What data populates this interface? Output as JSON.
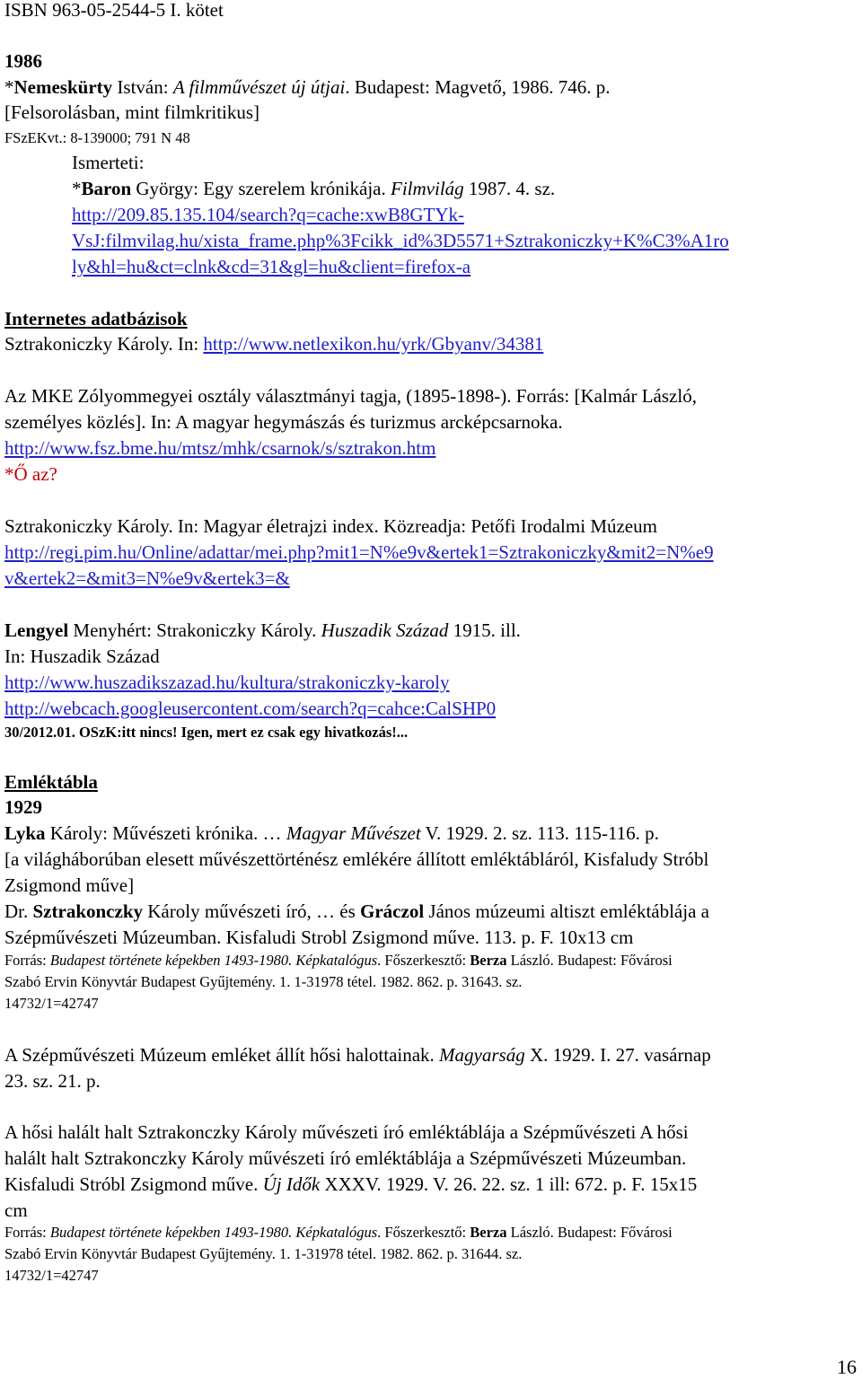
{
  "header": {
    "isbn": "ISBN 963-05-2544-5 I. kötet"
  },
  "sec1986": {
    "year": "1986",
    "l1": {
      "star": "*",
      "author": "Nemeskürty",
      "rest1": " István: ",
      "title": "A filmművészet új útjai",
      "rest2": ". Budapest: Magvető, 1986. 746. p."
    },
    "l2": "[Felsorolásban, mint filmkritikus]",
    "l3": "FSzEKvt.: 8-139000; 791 N 48",
    "ismerteti": "Ismerteti:",
    "baron": {
      "star": "*",
      "author": "Baron",
      "rest1": " György: Egy szerelem krónikája. ",
      "journal": "Filmvilág",
      "rest2": " 1987. 4. sz."
    },
    "url_lines": [
      "http://209.85.135.104/search?q=cache:xwB8GTYk-",
      "VsJ:filmvilag.hu/xista_frame.php%3Fcikk_id%3D5571+Sztrakoniczky+K%C3%A1ro",
      "ly&hl=hu&ct=clnk&cd=31&gl=hu&client=firefox-a"
    ]
  },
  "internet": {
    "heading": "Internetes adatbázisok",
    "netlex": {
      "text": "Sztrakoniczky Károly. In: ",
      "url": "http://www.netlexikon.hu/yrk/Gbyanv/34381"
    },
    "mke": [
      "Az MKE Zólyommegyei osztály választmányi tagja, (1895-1898-). Forrás: [Kalmár László,",
      "személyes közlés]. In: A magyar hegymászás és turizmus arcképcsarnoka."
    ],
    "fsz_url": "http://www.fsz.bme.hu/mtsz/mhk/csarnok/s/sztrakon.htm",
    "question": "*Ő az?",
    "pim": "Sztrakoniczky Károly. In: Magyar életrajzi index. Közreadja: Petőfi Irodalmi Múzeum",
    "pim_url_lines": [
      "http://regi.pim.hu/Online/adattar/mei.php?mit1=N%e9v&ertek1=Sztrakoniczky&mit2=N%e9",
      "v&ertek2=&mit3=N%e9v&ertek3=&"
    ],
    "lengyel": {
      "author": "Lengyel",
      "rest1": " Menyhért: Strakoniczky Károly. ",
      "journal": "Huszadik Század",
      "rest2": " 1915. ill."
    },
    "in_huszadik": "In: Huszadik Század",
    "huszadik_url": "http://www.huszadikszazad.hu/kultura/strakoniczky-karoly",
    "cache_url": "http://webcach.googleusercontent.com/search?q=cahce:CalSHP0",
    "note": "30/2012.01. OSzK:itt nincs! Igen, mert ez csak egy hivatkozás!..."
  },
  "emlektabla": {
    "heading": "Emléktábla",
    "year": "1929",
    "lyka": {
      "author": "Lyka",
      "rest1": " Károly: Művészeti krónika. … ",
      "journal": "Magyar Művészet",
      "rest2": " V. 1929. 2. sz. 113. 115-116. p."
    },
    "lyka_note": [
      "[a világháborúban elesett művészettörténész emlékére állított emléktábláról, Kisfaludy Stróbl",
      "Zsigmond műve]"
    ],
    "dr": {
      "p1": "Dr. ",
      "b1": "Sztrakonczky",
      "p2": " Károly művészeti író, … és ",
      "b2": "Gráczol",
      "p3": " János múzeumi altiszt emléktáblája a"
    },
    "dr2": "Szépművészeti Múzeumban. Kisfaludi Strobl Zsigmond műve. 113. p. F. 10x13 cm",
    "source1": {
      "p1": "Forrás: ",
      "it": "Budapest története képekben 1493-1980. Képkatalógus",
      "p2": ". Főszerkesztő: ",
      "b": "Berza",
      "p3": " László. Budapest: Fővárosi",
      "line2": "Szabó Ervin Könyvtár Budapest Gyűjtemény. 1. 1-31978 tétel. 1982. 862. p. 31643. sz.",
      "line3": "14732/1=42747"
    },
    "magyarsag": {
      "p1": "A Szépművészeti Múzeum emléket állít hősi halottainak. ",
      "journal": "Magyarság",
      "p2": " X. 1929. I. 27. vasárnap",
      "line2": "23. sz. 21. p."
    },
    "hosi": [
      "A hősi halált halt Sztrakonczky Károly művészeti író emléktáblája a Szépművészeti A hősi",
      "halált halt Sztrakonczky Károly művészeti író emléktáblája a Szépművészeti Múzeumban."
    ],
    "hosi3": {
      "p1": "Kisfaludi Stróbl Zsigmond műve. ",
      "journal": "Új Idők",
      "p2": " XXXV. 1929. V. 26. 22. sz. 1 ill: 672. p. F. 15x15"
    },
    "hosi4": "cm",
    "source2": {
      "p1": "Forrás: ",
      "it": "Budapest története képekben 1493-1980. Képkatalógus",
      "p2": ". Főszerkesztő: ",
      "b": "Berza",
      "p3": " László. Budapest: Fővárosi",
      "line2": "Szabó Ervin Könyvtár Budapest Gyűjtemény. 1. 1-31978 tétel. 1982. 862. p. 31644. sz.",
      "line3": "14732/1=42747"
    }
  },
  "footer": {
    "page_number": "16"
  },
  "colors": {
    "link": "#1f1fc8",
    "red": "#c00000",
    "text": "#000000"
  }
}
